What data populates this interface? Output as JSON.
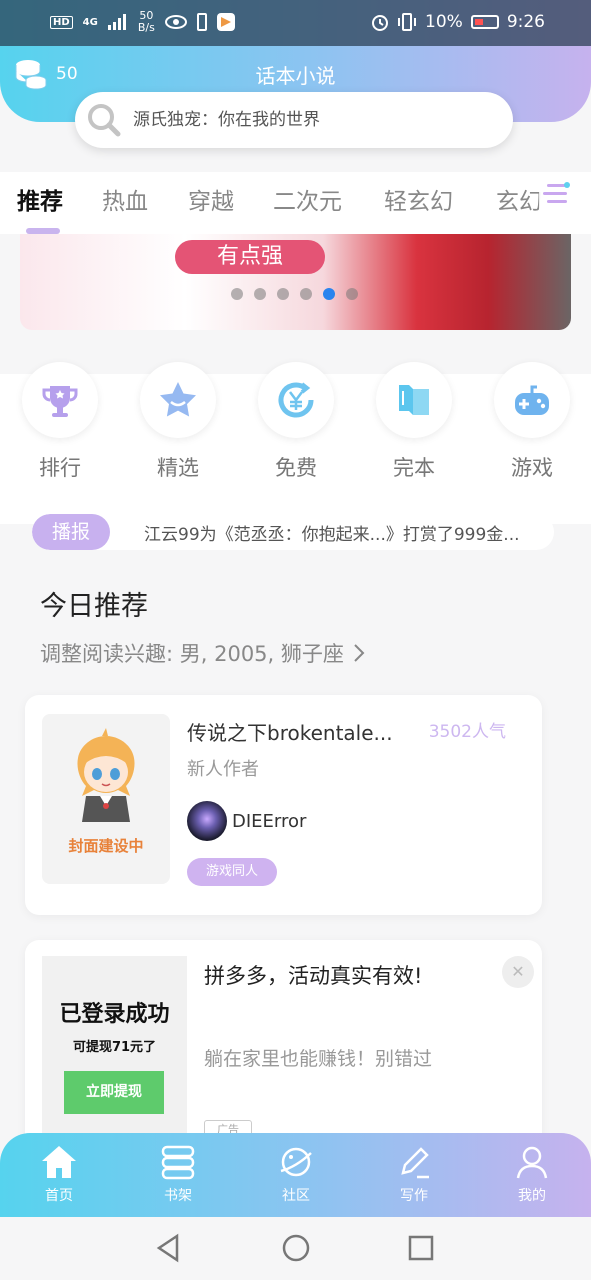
{
  "status_bar": {
    "hd": "HD",
    "network": "4G",
    "speed_value": "50",
    "speed_unit": "B/s",
    "battery": "10%",
    "time": "9:26"
  },
  "header": {
    "coins": "50",
    "app_title": "话本小说",
    "search_placeholder": "源氏独宠：你在我的世界"
  },
  "tabs": [
    {
      "label": "推荐",
      "active": true
    },
    {
      "label": "热血"
    },
    {
      "label": "穿越"
    },
    {
      "label": "二次元"
    },
    {
      "label": "轻玄幻"
    },
    {
      "label": "玄幻"
    }
  ],
  "banner": {
    "label": "有点强",
    "dots": 6,
    "active_dot": 4
  },
  "quick_nav": [
    {
      "label": "排行",
      "icon": "trophy-icon"
    },
    {
      "label": "精选",
      "icon": "star-icon"
    },
    {
      "label": "免费",
      "icon": "free-yen-icon"
    },
    {
      "label": "完本",
      "icon": "book-icon"
    },
    {
      "label": "游戏",
      "icon": "gamepad-icon"
    }
  ],
  "broadcast": {
    "tag": "播报",
    "text": "江云99为《范丞丞：你抱起来...》打赏了999金..."
  },
  "today": {
    "title": "今日推荐",
    "subtitle": "调整阅读兴趣: 男, 2005, 狮子座"
  },
  "book": {
    "cover_text": "封面建设中",
    "title": "传说之下brokentale...",
    "popularity": "3502人气",
    "author_label": "新人作者",
    "author_name": "DIEError",
    "genre": "游戏同人"
  },
  "ad": {
    "img_title": "已登录成功",
    "img_sub": "可提现71元了",
    "img_button": "立即提现",
    "title": "拼多多，活动真实有效!",
    "desc": "躺在家里也能赚钱！别错过",
    "close": "✕",
    "tag": "广告"
  },
  "bottom_nav": [
    {
      "label": "首页",
      "icon": "home-icon",
      "active": true
    },
    {
      "label": "书架",
      "icon": "bookshelf-icon"
    },
    {
      "label": "社区",
      "icon": "planet-icon"
    },
    {
      "label": "写作",
      "icon": "pen-icon"
    },
    {
      "label": "我的",
      "icon": "user-icon"
    }
  ],
  "colors": {
    "accent_purple": "#c8b1ef",
    "gradient_start": "#56d3ee",
    "gradient_end": "#c6b2ee",
    "active_dot": "#2a84ee"
  }
}
